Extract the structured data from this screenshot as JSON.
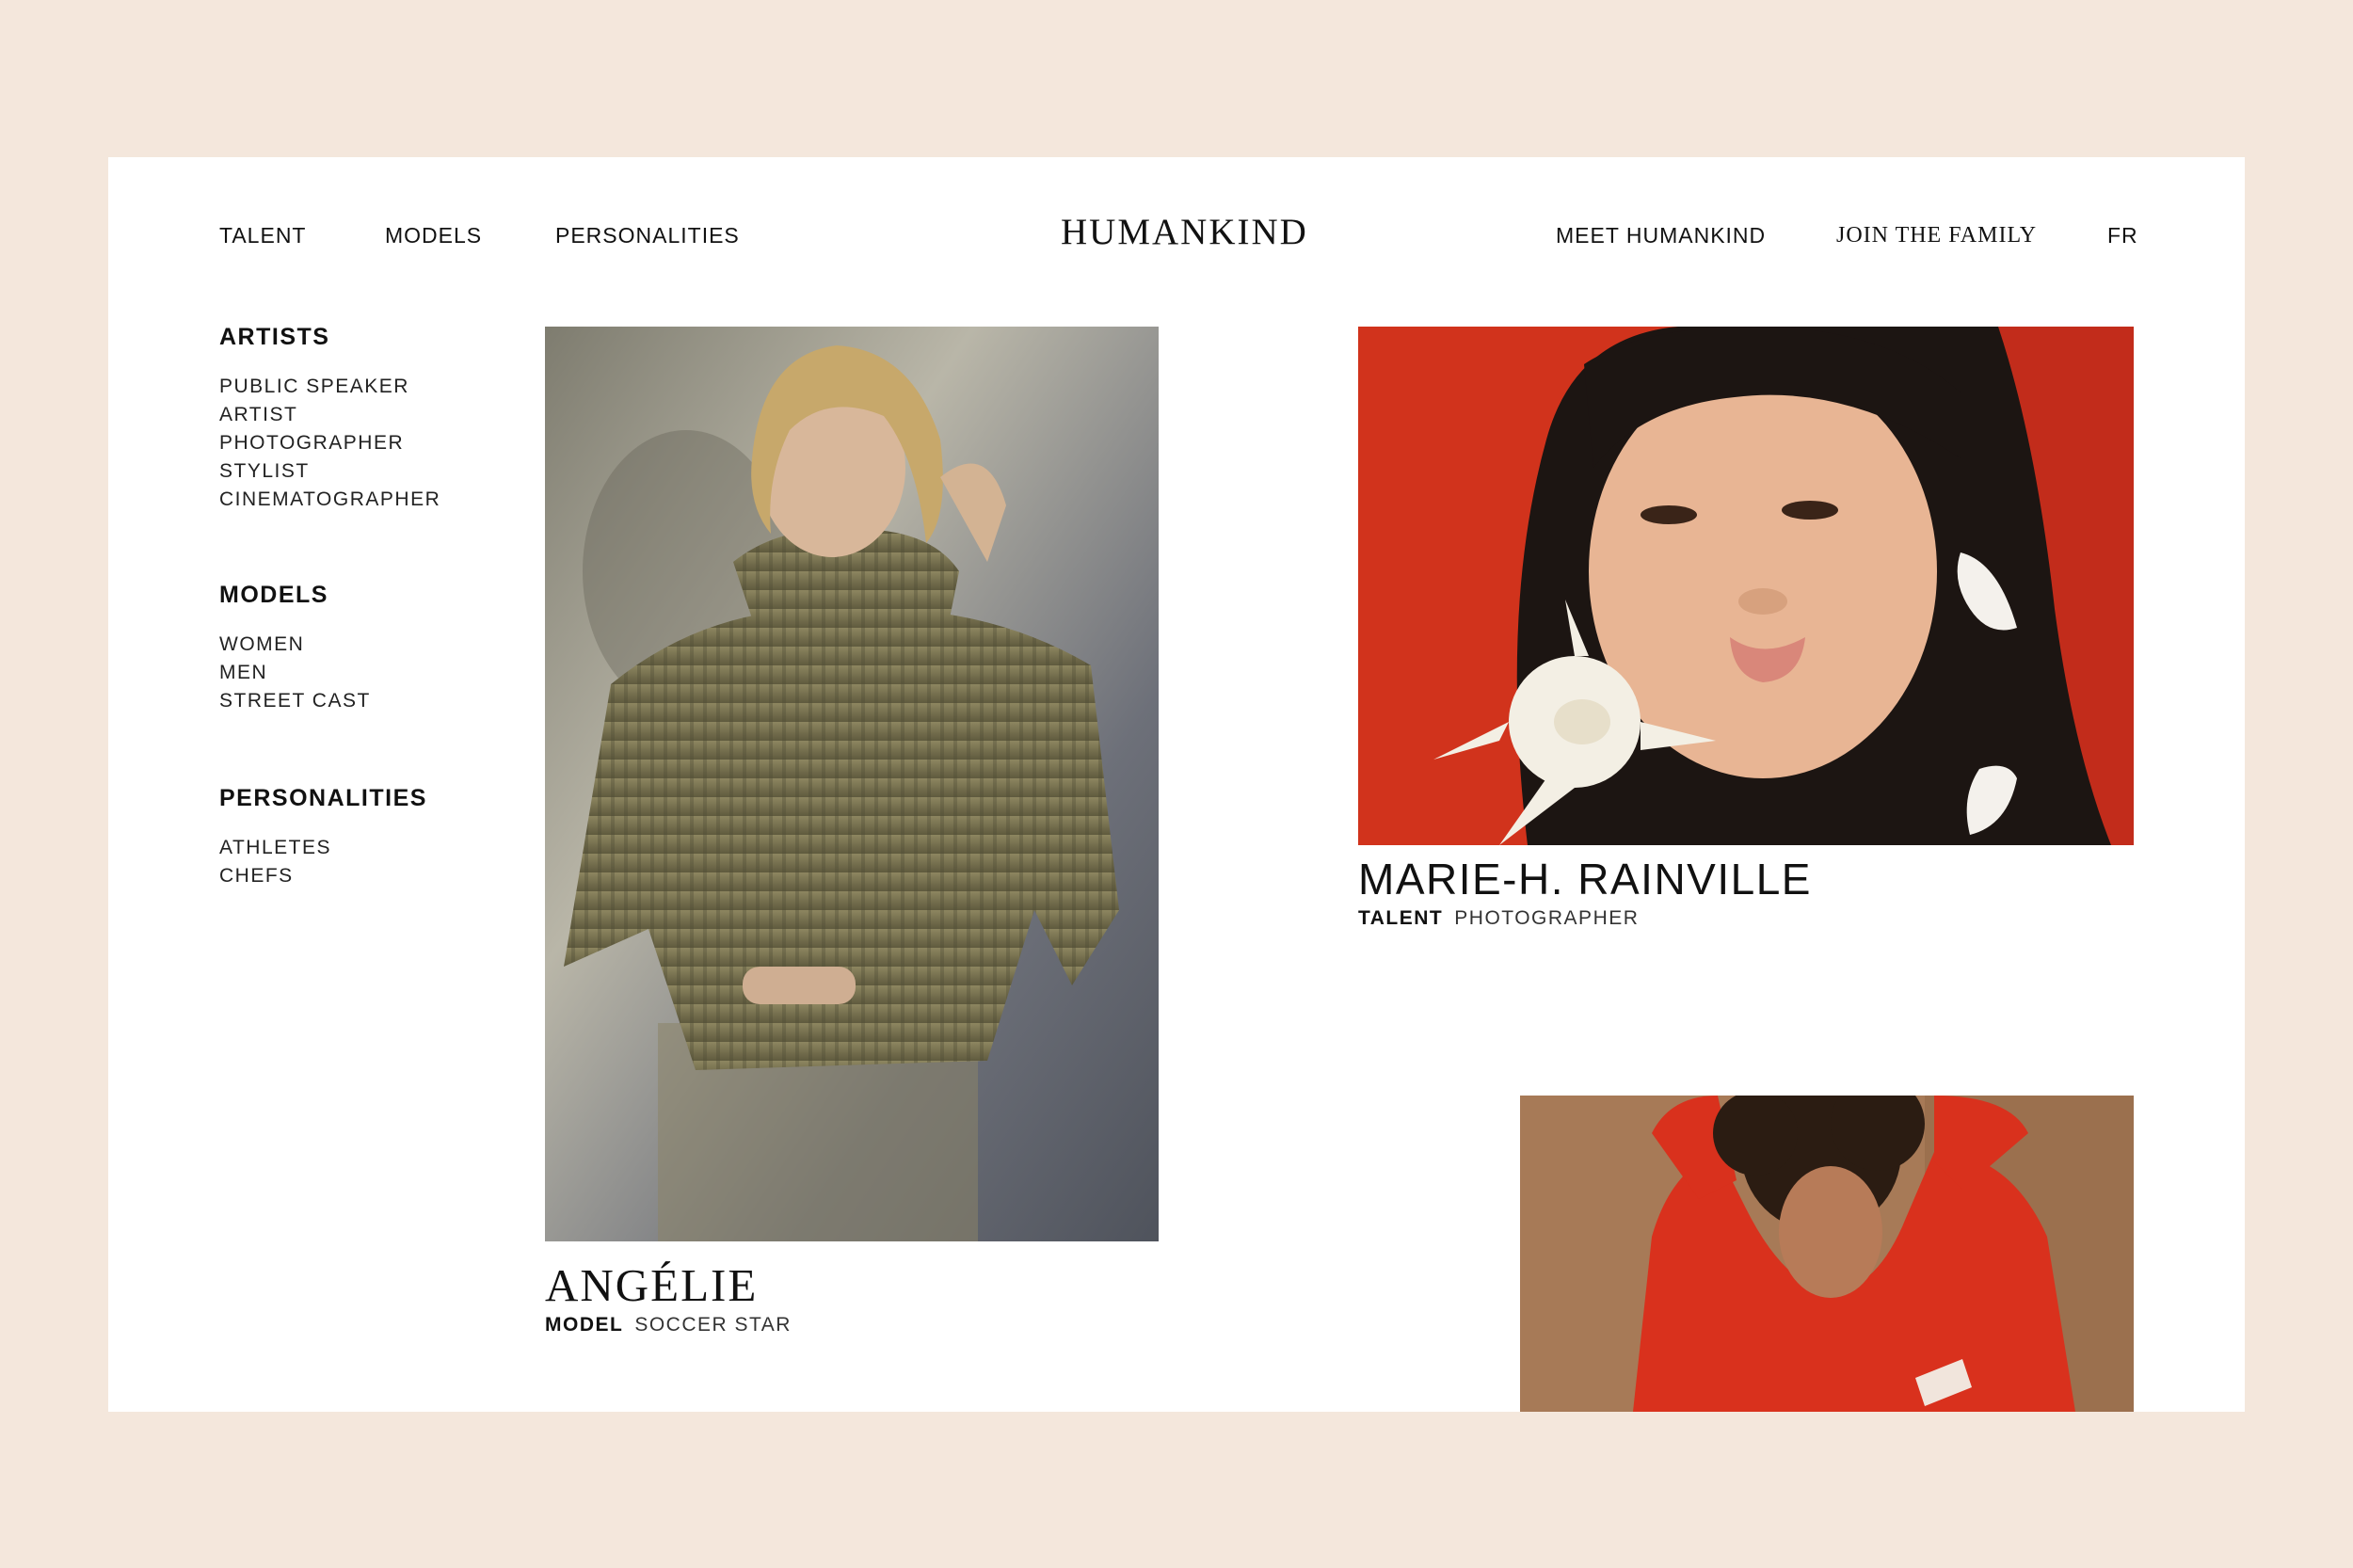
{
  "brand": {
    "logo": "HUMANKIND",
    "background_color": "#f4e7dc"
  },
  "nav": {
    "left": [
      "TALENT",
      "MODELS",
      "PERSONALITIES"
    ],
    "right": [
      "MEET HUMANKIND",
      "JOIN THE FAMILY"
    ],
    "language": "FR"
  },
  "sidebar": {
    "categories": [
      {
        "heading": "ARTISTS",
        "items": [
          "PUBLIC SPEAKER",
          "ARTIST",
          "PHOTOGRAPHER",
          "STYLIST",
          "CINEMATOGRAPHER"
        ]
      },
      {
        "heading": "MODELS",
        "items": [
          "WOMEN",
          "MEN",
          "STREET CAST"
        ]
      },
      {
        "heading": "PERSONALITIES",
        "items": [
          "ATHLETES",
          "CHEFS"
        ]
      }
    ]
  },
  "cards": [
    {
      "name": "ANGÉLIE",
      "tag": "MODEL",
      "role": "SOCCER STAR",
      "photo_icon": "portrait-olive-sweater"
    },
    {
      "name": "MARIE-H. RAINVILLE",
      "tag": "TALENT",
      "role": "PHOTOGRAPHER",
      "photo_icon": "portrait-red-background-flower"
    },
    {
      "photo_icon": "portrait-red-sweater"
    }
  ]
}
